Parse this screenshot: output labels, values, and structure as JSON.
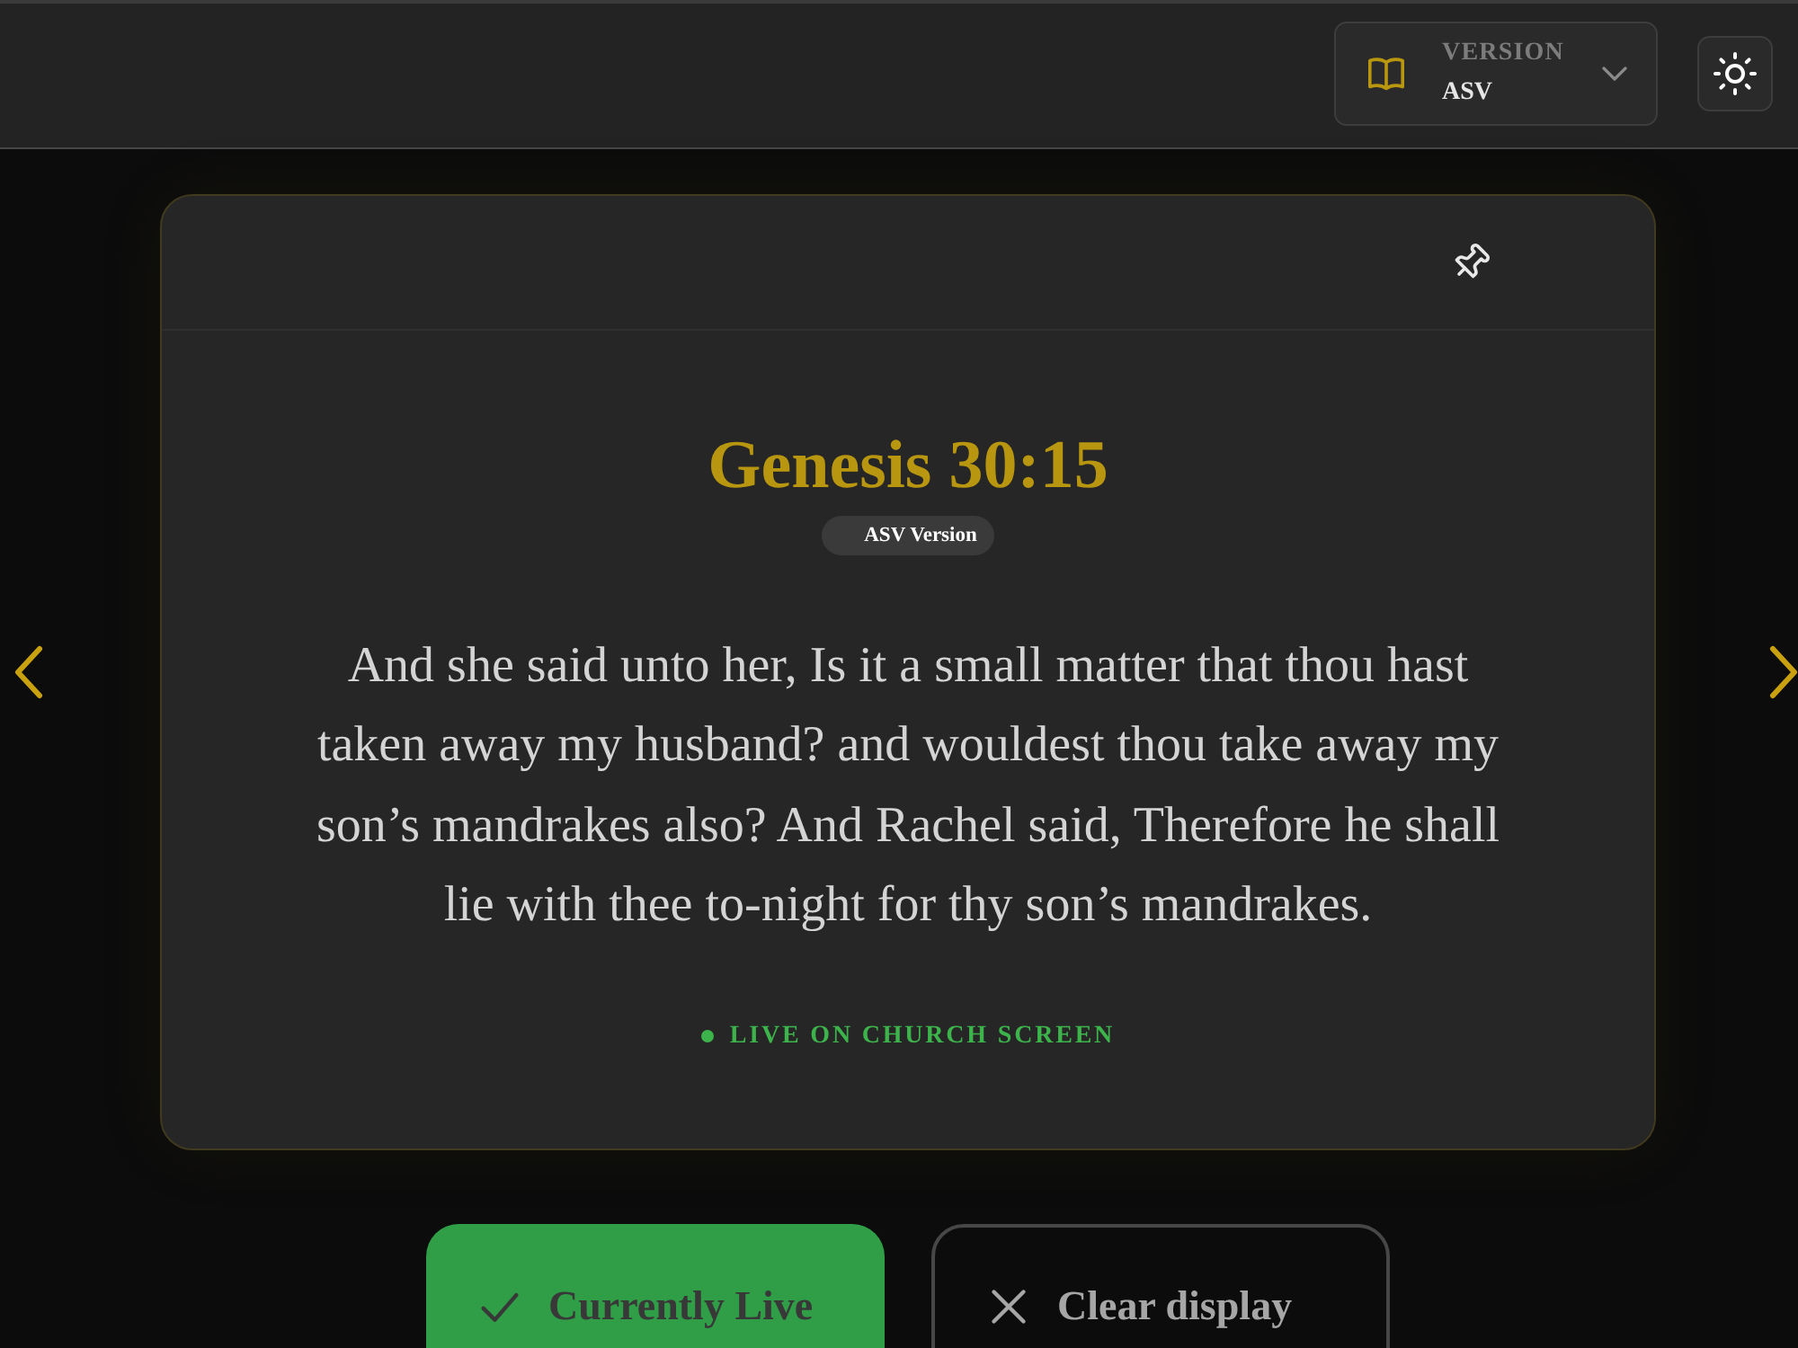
{
  "header": {
    "version_selector": {
      "label": "VERSION",
      "value": "ASV"
    }
  },
  "verse_card": {
    "reference": "Genesis 30:15",
    "version_badge": "ASV Version",
    "text": "And she said unto her, Is it a small matter that thou hast taken away my husband? and wouldest thou take away my son’s mandrakes also? And Rachel said, Therefore he shall lie with thee to-night for thy son’s mandrakes.",
    "live": true,
    "live_label": "LIVE ON CHURCH SCREEN"
  },
  "actions": [
    {
      "kind": "go_live",
      "label": "Currently Live",
      "disabled": true
    },
    {
      "kind": "clear",
      "label": "Clear display",
      "disabled": false
    }
  ]
}
